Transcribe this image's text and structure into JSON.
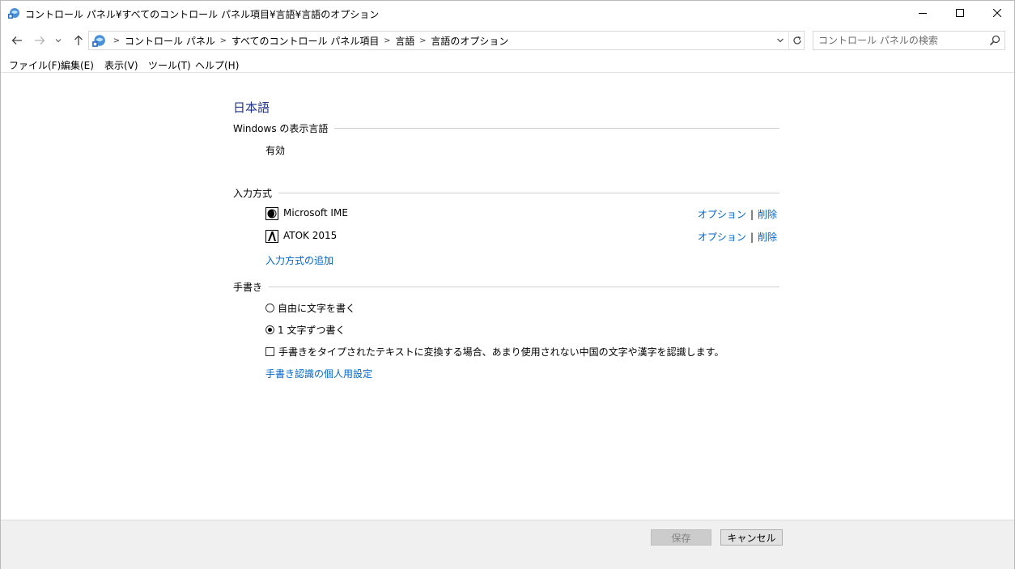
{
  "window": {
    "title": "コントロール パネル¥すべてのコントロール パネル項目¥言語¥言語のオプション"
  },
  "address": {
    "crumbs": [
      "コントロール パネル",
      "すべてのコントロール パネル項目",
      "言語",
      "言語のオプション"
    ]
  },
  "search": {
    "placeholder": "コントロール パネルの検索"
  },
  "menu": {
    "items": [
      "ファイル(F)",
      "編集(E)",
      "表示(V)",
      "ツール(T)",
      "ヘルプ(H)"
    ]
  },
  "language": {
    "title": "日本語"
  },
  "display_language": {
    "heading": "Windows の表示言語",
    "status": "有効"
  },
  "input_methods": {
    "heading": "入力方式",
    "items": [
      {
        "name": "Microsoft IME",
        "option_label": "オプション",
        "remove_label": "削除"
      },
      {
        "name": "ATOK 2015",
        "option_label": "オプション",
        "remove_label": "削除"
      }
    ],
    "add_link": "入力方式の追加"
  },
  "handwriting": {
    "heading": "手書き",
    "options": [
      {
        "label": "自由に文字を書く",
        "selected": false
      },
      {
        "label": "1 文字ずつ書く",
        "selected": true
      }
    ],
    "checkbox_label": "手書きをタイプされたテキストに変換する場合、あまり使用されない中国の文字や漢字を認識します。",
    "checkbox_checked": false,
    "personalize_link": "手書き認識の個人用設定"
  },
  "footer": {
    "save_label": "保存",
    "cancel_label": "キャンセル"
  },
  "colors": {
    "title_blue": "#1e3287",
    "link_blue": "#0066cc"
  }
}
